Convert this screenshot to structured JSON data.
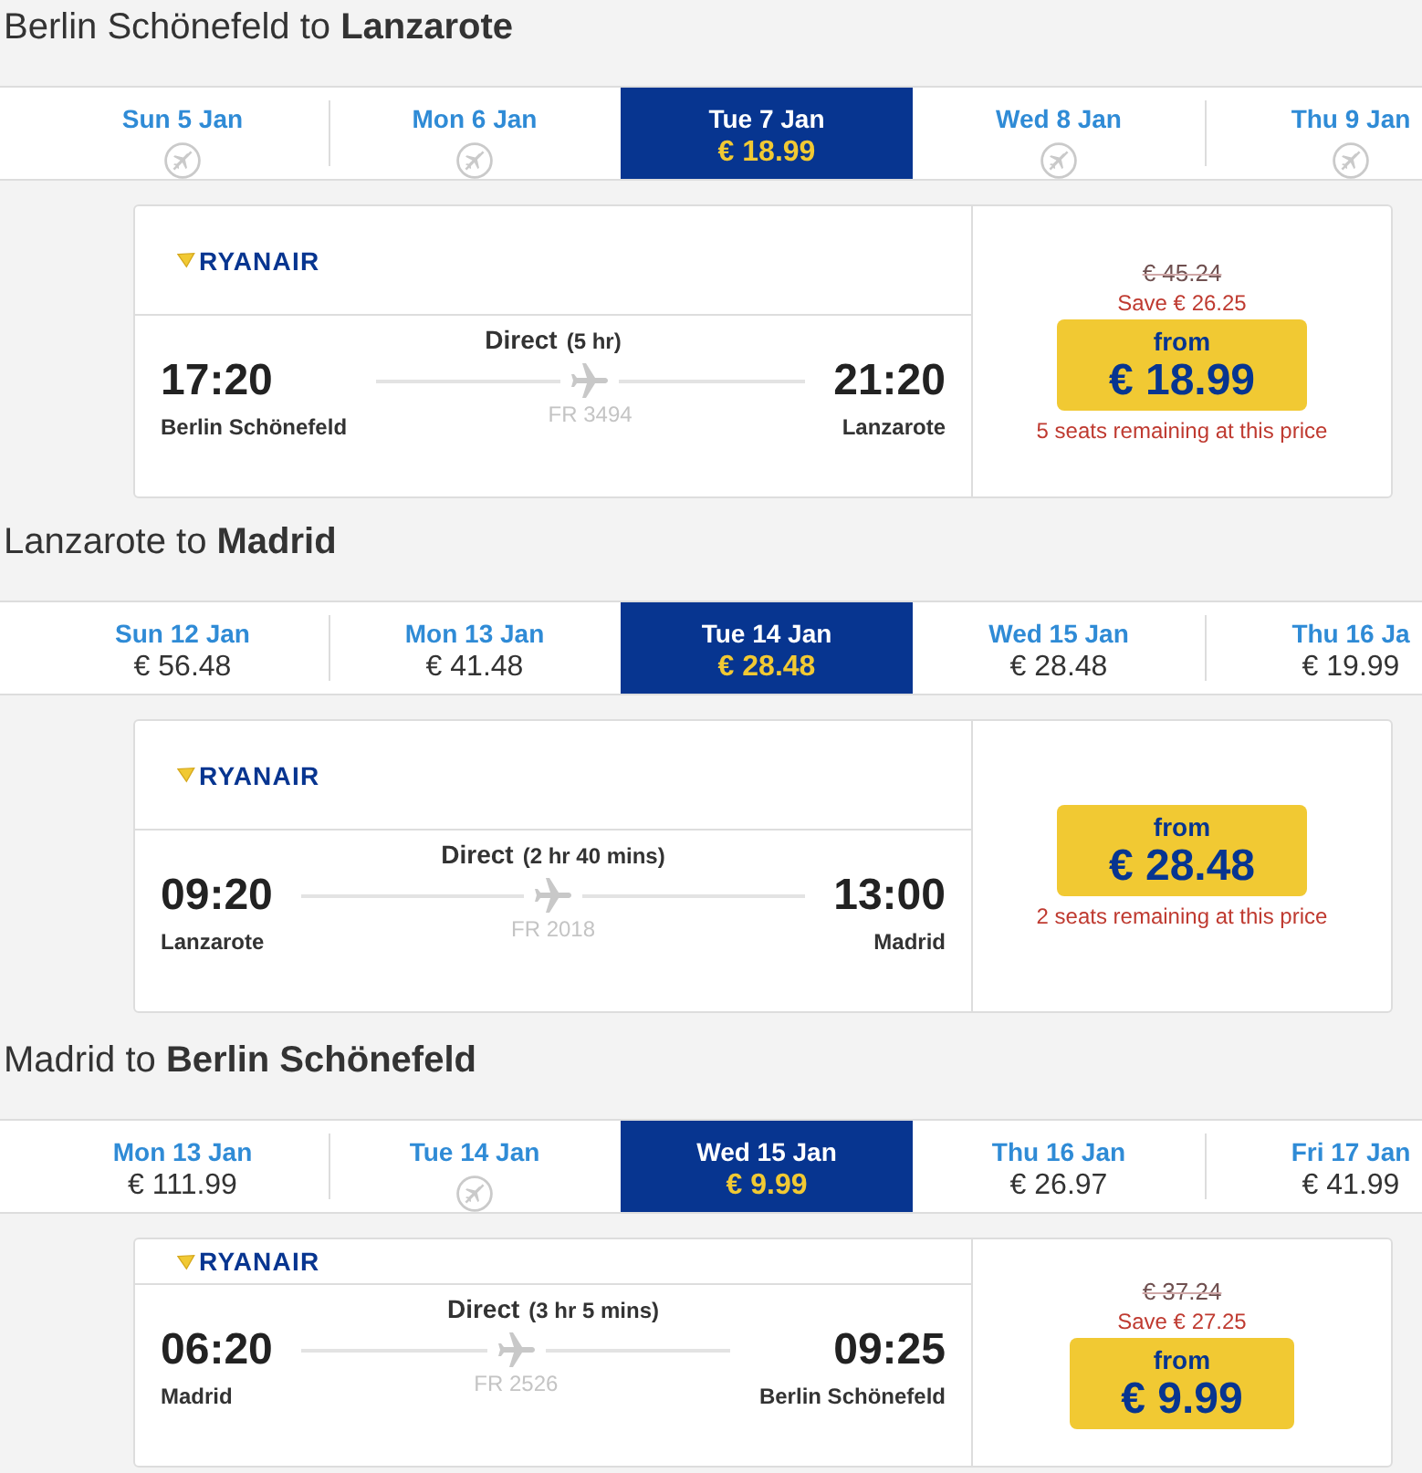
{
  "sections": [
    {
      "title": "Berlin Schönefeld to **Lanzarote**",
      "dates": [
        {
          "day": "Sun 5 Jan",
          "kind": "no_flights",
          "selected": false
        },
        {
          "day": "Mon 6 Jan",
          "kind": "no_flights",
          "selected": false
        },
        {
          "day": "Tue 7 Jan",
          "kind": "fare",
          "price": "€ 18.99",
          "selected": true
        },
        {
          "day": "Wed 8 Jan",
          "kind": "no_flights",
          "selected": false
        },
        {
          "day": "Thu 9 Jan",
          "kind": "no_flights",
          "selected": false
        }
      ],
      "flight": {
        "airline": "RYANAIR",
        "stops": "Direct",
        "duration": "(5 hr)",
        "departure": {
          "time": "17:20",
          "airport": "Berlin Schönefeld"
        },
        "flight_number": "FR 3494",
        "arrival": {
          "time": "21:20",
          "airport": "Lanzarote"
        },
        "was_price": "€ 45.24",
        "saving": "Save € 26.25",
        "button": {
          "label": "from",
          "price": "€ 18.99"
        },
        "seats_note": "5 seats remaining at this price"
      }
    },
    {
      "title": "Lanzarote to **Madrid**",
      "dates": [
        {
          "day": "Sun 12 Jan",
          "kind": "fare",
          "price": "€ 56.48",
          "selected": false
        },
        {
          "day": "Mon 13 Jan",
          "kind": "fare",
          "price": "€ 41.48",
          "selected": false
        },
        {
          "day": "Tue 14 Jan",
          "kind": "fare",
          "price": "€ 28.48",
          "selected": true
        },
        {
          "day": "Wed 15 Jan",
          "kind": "fare",
          "price": "€ 28.48",
          "selected": false
        },
        {
          "day": "Thu 16 Ja",
          "kind": "fare",
          "price": "€ 19.99",
          "selected": false
        }
      ],
      "flight": {
        "airline": "RYANAIR",
        "stops": "Direct",
        "duration": "(2 hr 40 mins)",
        "departure": {
          "time": "09:20",
          "airport": "Lanzarote"
        },
        "flight_number": "FR 2018",
        "arrival": {
          "time": "13:00",
          "airport": "Madrid"
        },
        "button": {
          "label": "from",
          "price": "€ 28.48"
        },
        "seats_note": "2 seats remaining at this price"
      }
    },
    {
      "title": "Madrid to **Berlin Schönefeld**",
      "dates": [
        {
          "day": "Mon 13 Jan",
          "kind": "fare",
          "price": "€ 111.99",
          "selected": false
        },
        {
          "day": "Tue 14 Jan",
          "kind": "no_flights",
          "selected": false
        },
        {
          "day": "Wed 15 Jan",
          "kind": "fare",
          "price": "€ 9.99",
          "selected": true
        },
        {
          "day": "Thu 16 Jan",
          "kind": "fare",
          "price": "€ 26.97",
          "selected": false
        },
        {
          "day": "Fri 17 Jan",
          "kind": "fare",
          "price": "€ 41.99",
          "selected": false
        }
      ],
      "flight": {
        "airline": "RYANAIR",
        "stops": "Direct",
        "duration": "(3 hr 5 mins)",
        "departure": {
          "time": "06:20",
          "airport": "Madrid"
        },
        "flight_number": "FR 2526",
        "arrival": {
          "time": "09:25",
          "airport": "Berlin Schönefeld"
        },
        "was_price": "€ 37.24",
        "saving": "Save € 27.25",
        "button": {
          "label": "from",
          "price": "€ 9.99"
        }
      }
    }
  ]
}
